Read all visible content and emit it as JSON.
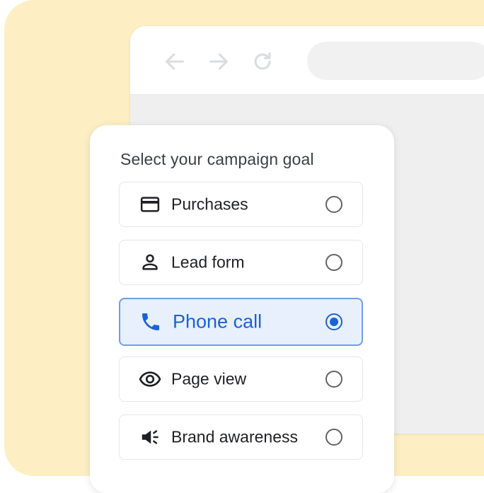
{
  "colors": {
    "background_panel": "#fdefc3",
    "accent_blue": "#1a63d3",
    "selected_fill": "#e8f0fe",
    "text_primary": "#202124"
  },
  "browser": {
    "nav_icons": [
      "back-arrow-icon",
      "forward-arrow-icon",
      "reload-icon"
    ]
  },
  "card": {
    "title": "Select your campaign goal",
    "options": [
      {
        "label": "Purchases",
        "icon": "credit-card-icon",
        "selected": false
      },
      {
        "label": "Lead form",
        "icon": "person-icon",
        "selected": false
      },
      {
        "label": "Phone call",
        "icon": "phone-icon",
        "selected": true
      },
      {
        "label": "Page view",
        "icon": "eye-icon",
        "selected": false
      },
      {
        "label": "Brand awareness",
        "icon": "megaphone-icon",
        "selected": false
      }
    ]
  }
}
